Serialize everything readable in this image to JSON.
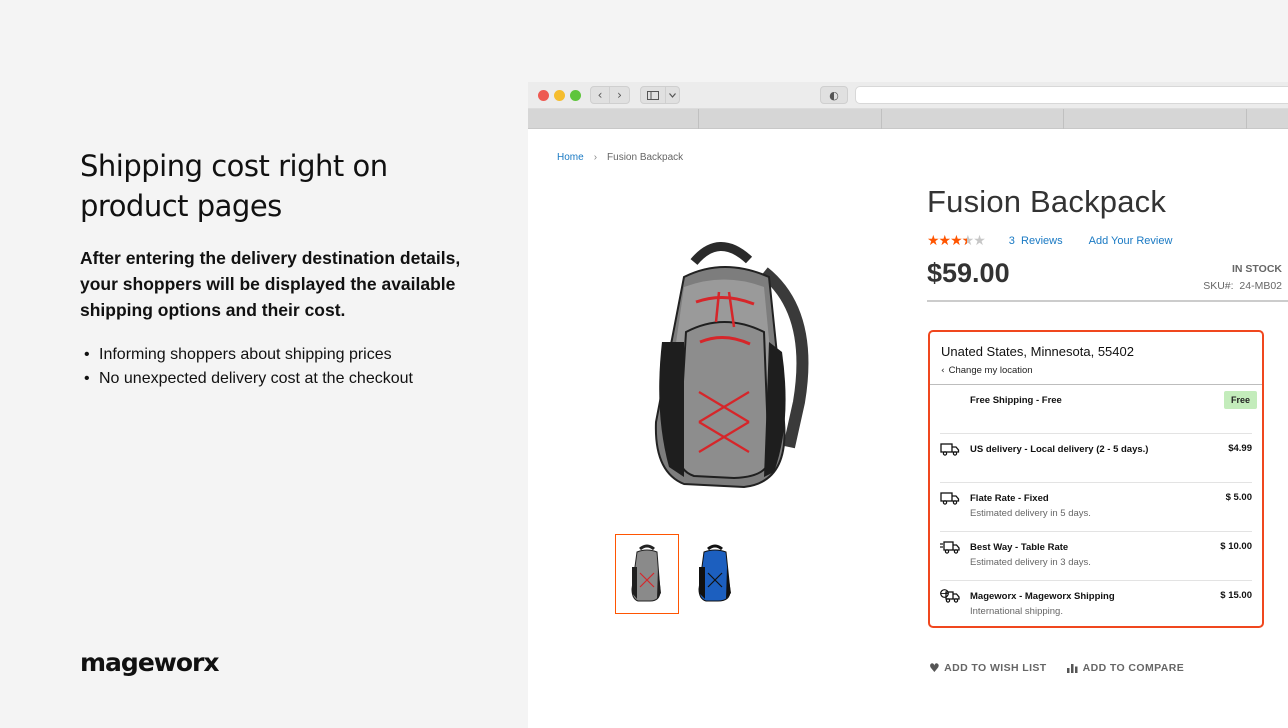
{
  "promo": {
    "title": "Shipping cost right on product pages",
    "description": "After entering the delivery destination details, your shoppers will be displayed the available shipping options and their cost.",
    "bullets": [
      "Informing shoppers about shipping prices",
      "No unexpected delivery cost at the checkout"
    ],
    "logo": "mageworx"
  },
  "browser": {
    "back_icon": "‹",
    "forward_icon": "›",
    "sidebar_icon": "▯",
    "dropdown_icon": "⌄",
    "shield_icon": "◐"
  },
  "breadcrumb": {
    "home": "Home",
    "separator": "›",
    "current": "Fusion Backpack"
  },
  "product": {
    "name": "Fusion Backpack",
    "rating_stars_filled": 3.5,
    "rating_max": 5,
    "reviews_count": "3",
    "reviews_label": "Reviews",
    "add_review": "Add Your Review",
    "price": "$59.00",
    "stock": "IN STOCK",
    "sku_label": "SKU#:",
    "sku": "24-MB02"
  },
  "shipping": {
    "location": "Unated States, Minnesota, 55402",
    "change_location": "Change my location",
    "change_icon": "‹",
    "options": [
      {
        "title": "Free Shipping - Free",
        "description": "",
        "price": "Free",
        "icon": "none",
        "is_free": true
      },
      {
        "title": "US delivery - Local delivery (2 - 5 days.)",
        "description": "",
        "price": "$4.99",
        "icon": "truck-icon",
        "is_free": false
      },
      {
        "title": "Flate Rate - Fixed",
        "description": "Estimated delivery in 5 days.",
        "price": "$ 5.00",
        "icon": "truck-icon",
        "is_free": false
      },
      {
        "title": "Best Way - Table Rate",
        "description": "Estimated delivery in 3 days.",
        "price": "$ 10.00",
        "icon": "fast-truck-icon",
        "is_free": false
      },
      {
        "title": "Mageworx - Mageworx Shipping",
        "description": "International shipping.",
        "price": "$ 15.00",
        "icon": "global-truck-icon",
        "is_free": false
      }
    ]
  },
  "actions": {
    "wishlist": "ADD TO WISH LIST",
    "wishlist_icon": "♥",
    "compare": "ADD TO COMPARE",
    "compare_icon": "▮"
  },
  "colors": {
    "accent": "#ff5501",
    "link": "#1979c3",
    "box_border": "#f0471e",
    "free_badge": "#c3ecbb"
  }
}
